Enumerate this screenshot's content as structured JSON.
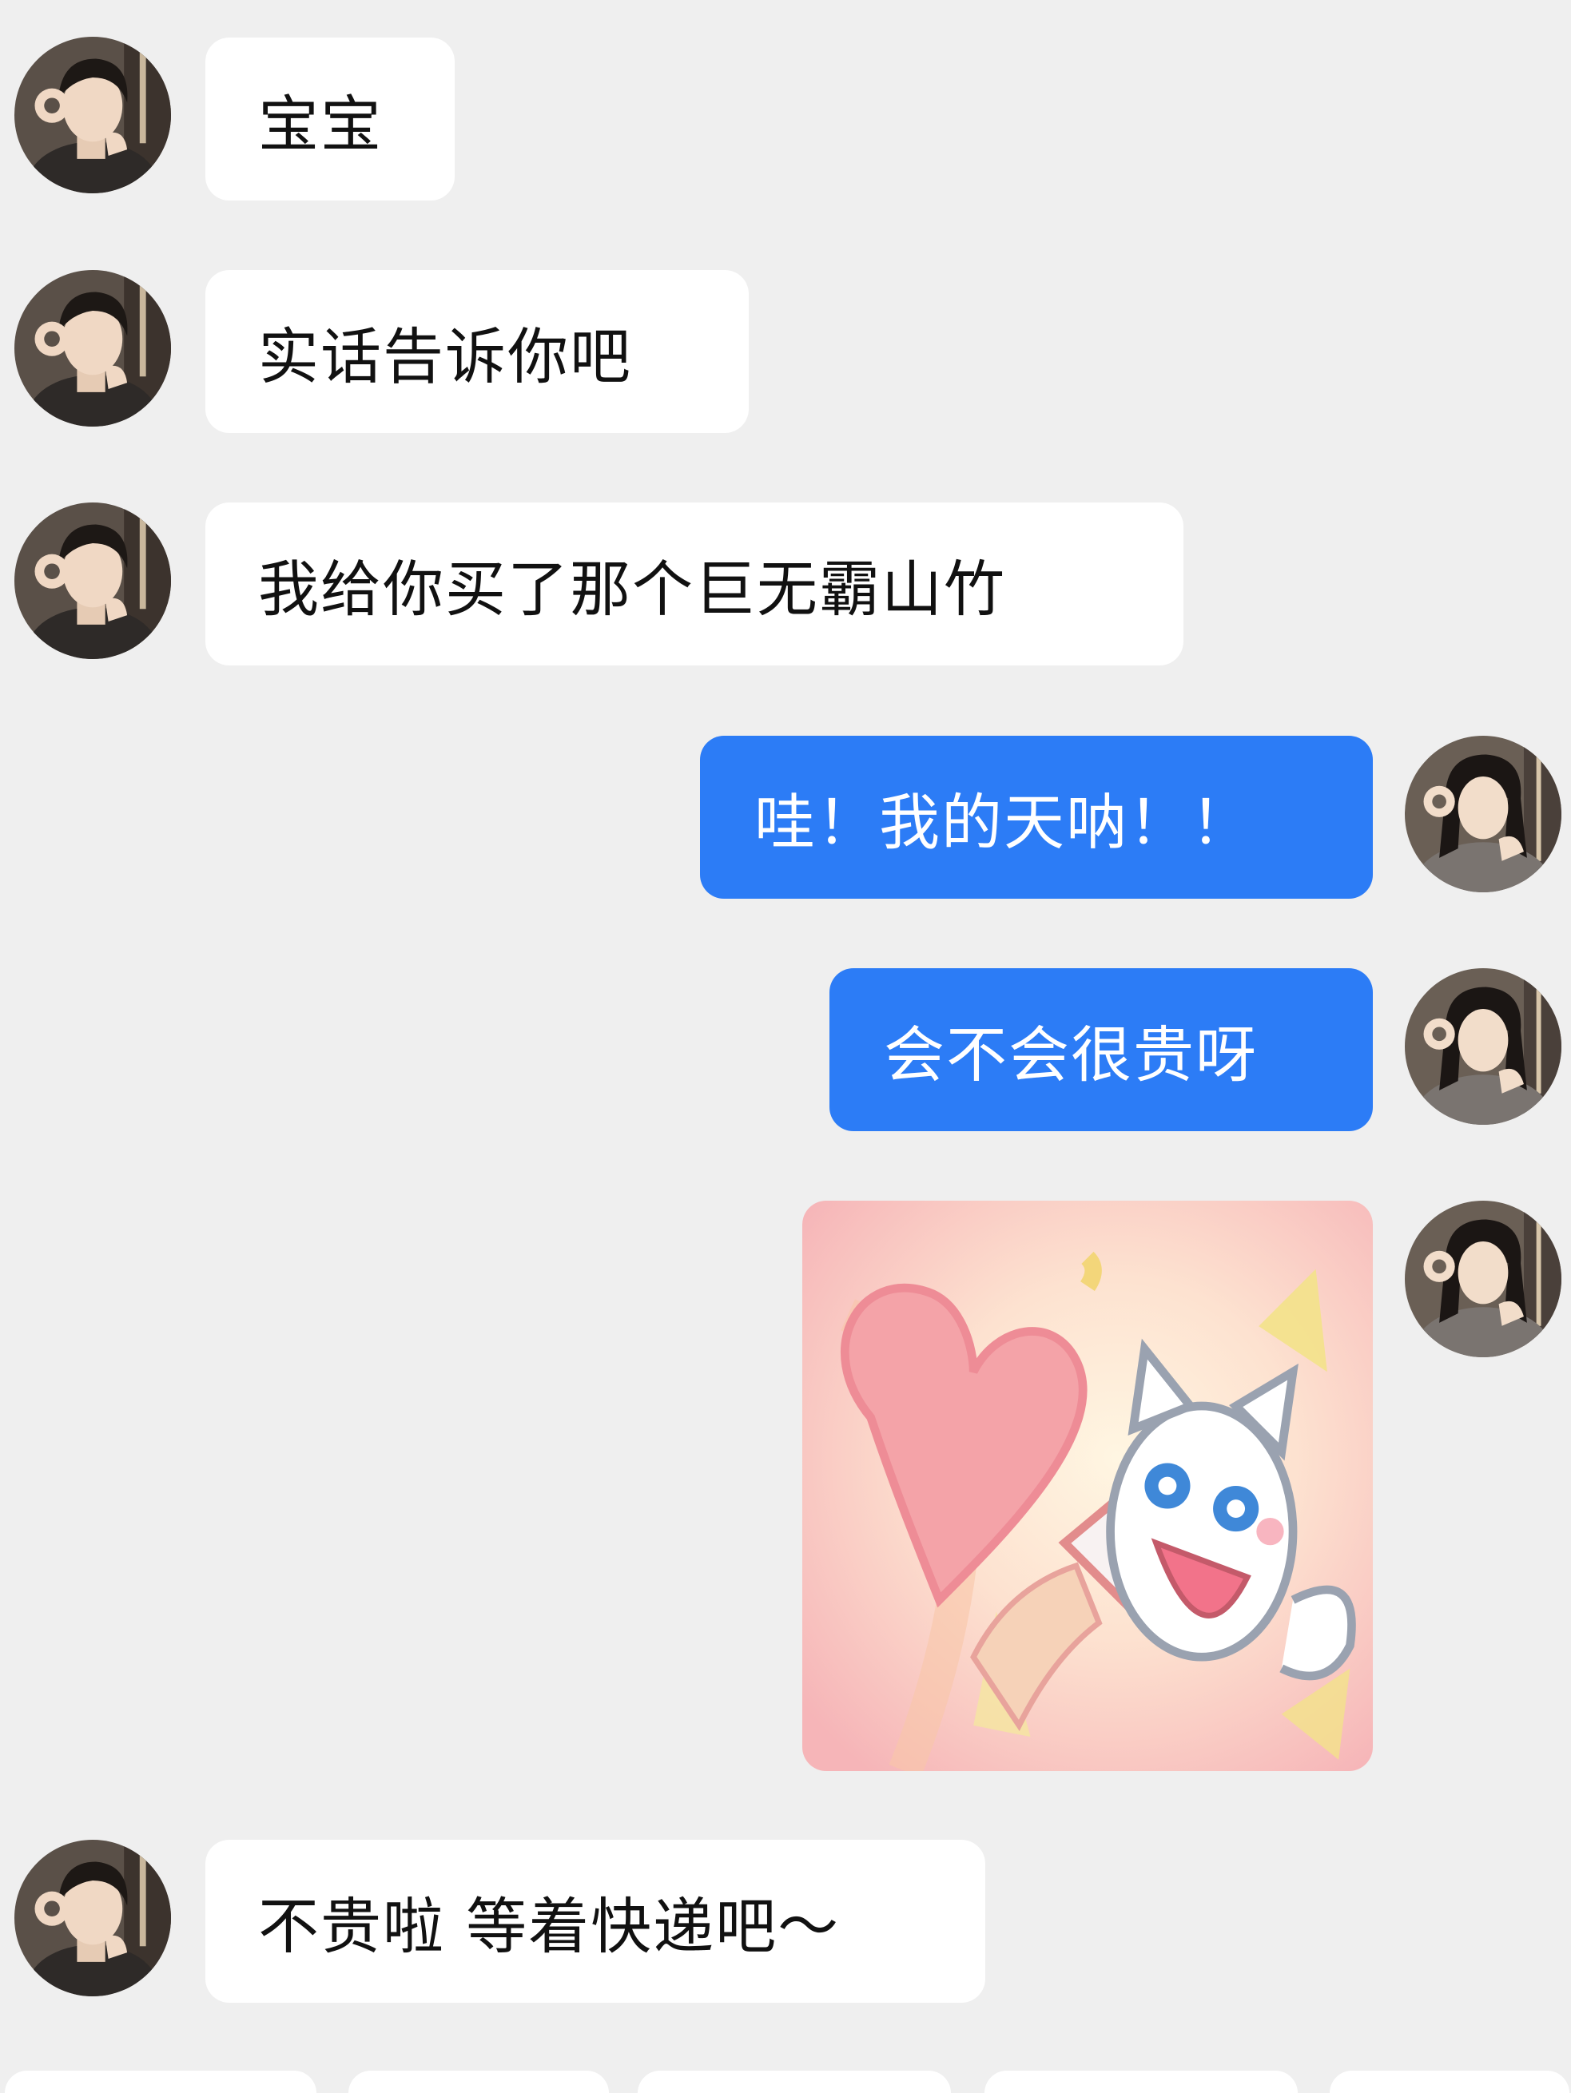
{
  "messages": [
    {
      "side": "incoming",
      "text": "宝宝"
    },
    {
      "side": "incoming",
      "text": "实话告诉你吧"
    },
    {
      "side": "incoming",
      "text": "我给你买了那个巨无霸山竹"
    },
    {
      "side": "outgoing",
      "text": "哇！我的天呐！！"
    },
    {
      "side": "outgoing",
      "text": "会不会很贵呀"
    },
    {
      "side": "outgoing",
      "type": "sticker",
      "sticker_icon": "cat-heart-sticker-icon"
    },
    {
      "side": "incoming",
      "text": "不贵啦 等着快递吧～"
    }
  ],
  "colors": {
    "background": "#efefef",
    "incoming_bubble": "#ffffff",
    "outgoing_bubble": "#2c7cf6",
    "outgoing_text": "#ffffff"
  }
}
